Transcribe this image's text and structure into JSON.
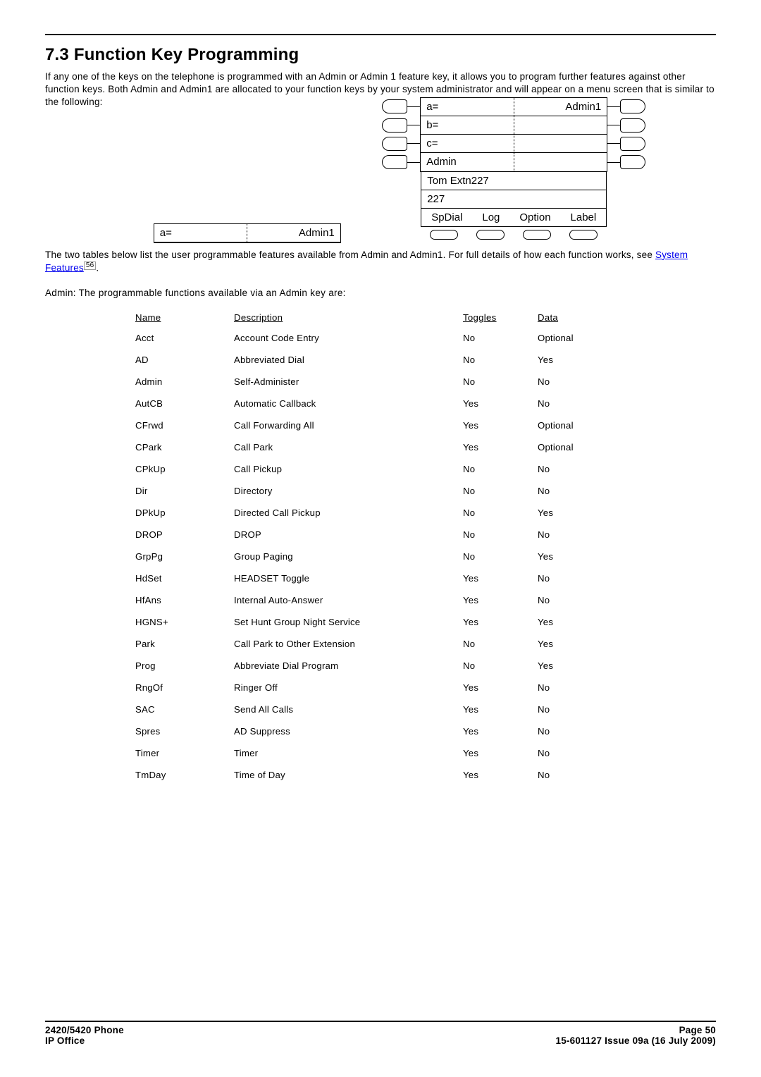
{
  "heading": "7.3 Function Key Programming",
  "intro1": "If any one of the keys on the telephone is programmed with an Admin or Admin 1 feature key, it allows you to program further features against other function keys. Both Admin and Admin1 are allocated to your function keys by your system administrator and will appear on a menu screen that is similar to the following:",
  "lcd": {
    "rows": [
      {
        "left": "a=",
        "right": "Admin1"
      },
      {
        "left": "b=",
        "right": ""
      },
      {
        "left": "c=",
        "right": ""
      },
      {
        "left": "Admin",
        "right": ""
      }
    ],
    "user": "Tom Extn227",
    "ext": "227",
    "softkeys": [
      "SpDial",
      "Log",
      "Option",
      "Label"
    ]
  },
  "intro2a": "The two tables below list the user programmable features available from Admin and Admin1. For full details of how each function works, see ",
  "intro2_link": "System Features",
  "intro2_ref": "56",
  "intro2b": ".",
  "subhead": "Admin: The programmable functions available via an Admin key are:",
  "table": {
    "headers": {
      "name": "Name",
      "desc": "Description",
      "toggles": "Toggles",
      "data": "Data"
    },
    "rows": [
      {
        "name": "Acct",
        "desc": "Account Code Entry",
        "toggles": "No",
        "data": "Optional"
      },
      {
        "name": "AD",
        "desc": "Abbreviated Dial",
        "toggles": "No",
        "data": "Yes"
      },
      {
        "name": "Admin",
        "desc": "Self-Administer",
        "toggles": "No",
        "data": "No"
      },
      {
        "name": "AutCB",
        "desc": "Automatic Callback",
        "toggles": "Yes",
        "data": "No"
      },
      {
        "name": "CFrwd",
        "desc": "Call Forwarding All",
        "toggles": "Yes",
        "data": "Optional"
      },
      {
        "name": "CPark",
        "desc": "Call Park",
        "toggles": "Yes",
        "data": "Optional"
      },
      {
        "name": "CPkUp",
        "desc": "Call Pickup",
        "toggles": "No",
        "data": "No"
      },
      {
        "name": "Dir",
        "desc": "Directory",
        "toggles": "No",
        "data": "No"
      },
      {
        "name": "DPkUp",
        "desc": "Directed Call Pickup",
        "toggles": "No",
        "data": "Yes"
      },
      {
        "name": "DROP",
        "desc": "DROP",
        "toggles": "No",
        "data": "No"
      },
      {
        "name": "GrpPg",
        "desc": "Group Paging",
        "toggles": "No",
        "data": "Yes"
      },
      {
        "name": "HdSet",
        "desc": "HEADSET Toggle",
        "toggles": "Yes",
        "data": "No"
      },
      {
        "name": "HfAns",
        "desc": "Internal Auto-Answer",
        "toggles": "Yes",
        "data": "No"
      },
      {
        "name": "HGNS+",
        "desc": "Set Hunt Group Night Service",
        "toggles": "Yes",
        "data": "Yes"
      },
      {
        "name": "Park",
        "desc": "Call Park to Other Extension",
        "toggles": "No",
        "data": "Yes"
      },
      {
        "name": "Prog",
        "desc": "Abbreviate Dial Program",
        "toggles": "No",
        "data": "Yes"
      },
      {
        "name": "RngOf",
        "desc": "Ringer Off",
        "toggles": "Yes",
        "data": "No"
      },
      {
        "name": "SAC",
        "desc": "Send All Calls",
        "toggles": "Yes",
        "data": "No"
      },
      {
        "name": "Spres",
        "desc": "AD Suppress",
        "toggles": "Yes",
        "data": "No"
      },
      {
        "name": "Timer",
        "desc": "Timer",
        "toggles": "Yes",
        "data": "No"
      },
      {
        "name": "TmDay",
        "desc": "Time of Day",
        "toggles": "Yes",
        "data": "No"
      }
    ]
  },
  "footer": {
    "left1": "2420/5420 Phone",
    "left2": "IP Office",
    "right1": "Page 50",
    "right2": "15-601127 Issue 09a (16 July 2009)"
  }
}
